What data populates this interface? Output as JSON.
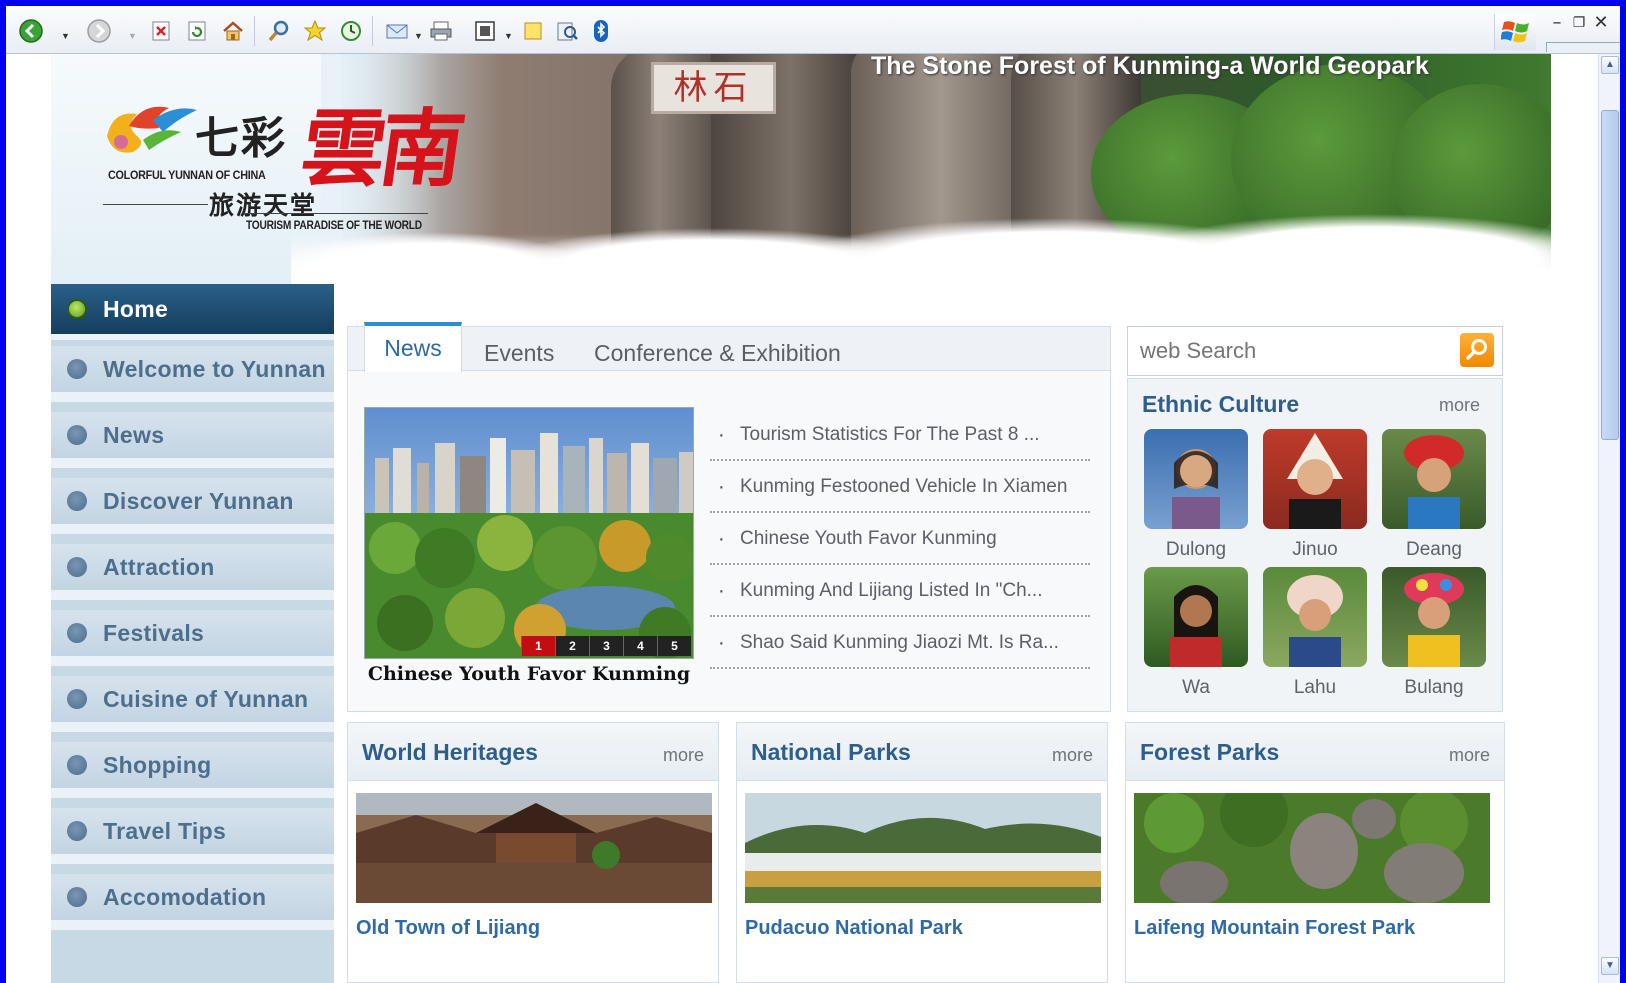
{
  "browser": {
    "toolbar_icons": [
      "back-icon",
      "forward-icon",
      "stop-icon",
      "refresh-icon",
      "home-icon",
      "search-icon",
      "favorites-icon",
      "history-icon",
      "mail-icon",
      "print-icon",
      "edit-icon",
      "note-icon",
      "research-icon",
      "bluetooth-icon"
    ]
  },
  "banner": {
    "title": "The Stone Forest of Kunming-a World Geopark",
    "sign": "林石"
  },
  "logo": {
    "cn_colorful": "七彩",
    "cn_yunnan": "雲南",
    "en_line1": "COLORFUL YUNNAN OF CHINA",
    "cn_tourism": "旅游天堂",
    "en_line2": "TOURISM PARADISE OF THE WORLD"
  },
  "nav": {
    "items": [
      {
        "label": "Home",
        "active": true
      },
      {
        "label": "Welcome to Yunnan"
      },
      {
        "label": "News"
      },
      {
        "label": "Discover Yunnan"
      },
      {
        "label": "Attraction"
      },
      {
        "label": "Festivals"
      },
      {
        "label": "Cuisine of Yunnan"
      },
      {
        "label": "Shopping"
      },
      {
        "label": "Travel Tips"
      },
      {
        "label": "Accomodation"
      }
    ]
  },
  "news": {
    "tabs": [
      "News",
      "Events",
      "Conference & Exhibition"
    ],
    "photo_caption": "Chinese Youth Favor Kunming",
    "pager": [
      "1",
      "2",
      "3",
      "4",
      "5"
    ],
    "headlines": [
      "Tourism Statistics For The Past 8 ...",
      "Kunming Festooned Vehicle In Xiamen",
      "Chinese Youth Favor Kunming",
      "Kunming And Lijiang Listed In \"Ch...",
      "Shao Said Kunming Jiaozi Mt. Is Ra..."
    ]
  },
  "search": {
    "placeholder": "web Search"
  },
  "ethnic": {
    "title": "Ethnic Culture",
    "more": "more",
    "people": [
      "Dulong",
      "Jinuo",
      "Deang",
      "Wa",
      "Lahu",
      "Bulang"
    ]
  },
  "cards": [
    {
      "title": "World Heritages",
      "more": "more",
      "caption": "Old Town of Lijiang"
    },
    {
      "title": "National Parks",
      "more": "more",
      "caption": "Pudacuo National Park"
    },
    {
      "title": "Forest Parks",
      "more": "more",
      "caption": "Laifeng Mountain Forest Park"
    }
  ],
  "colors": {
    "nav_active": "#1d4d72",
    "link_blue": "#2e6aa6",
    "accent_orange": "#f39a12",
    "pager_active": "#c40d12"
  }
}
